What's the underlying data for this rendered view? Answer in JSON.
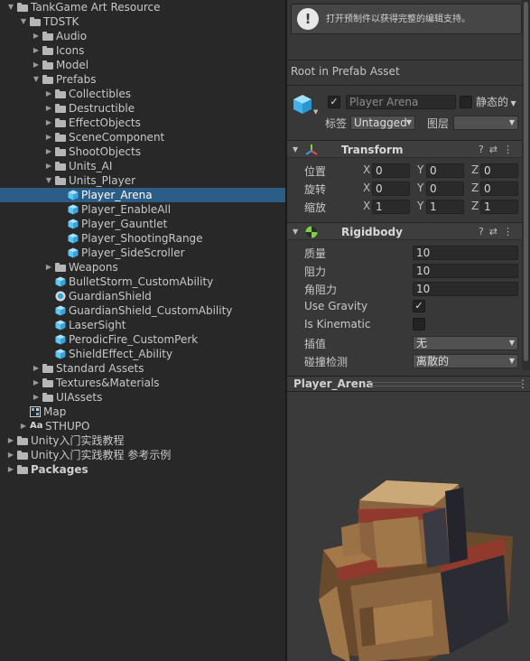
{
  "project_tree": {
    "items": [
      {
        "label": "TankGame Art Resource",
        "kind": "folder",
        "expanded": true
      },
      {
        "label": "TDSTK",
        "kind": "folder",
        "expanded": true
      },
      {
        "label": "Audio",
        "kind": "folder",
        "expanded": false
      },
      {
        "label": "Icons",
        "kind": "folder",
        "expanded": false
      },
      {
        "label": "Model",
        "kind": "folder",
        "expanded": false
      },
      {
        "label": "Prefabs",
        "kind": "folder",
        "expanded": true
      },
      {
        "label": "Collectibles",
        "kind": "folder",
        "expanded": false
      },
      {
        "label": "Destructible",
        "kind": "folder",
        "expanded": false
      },
      {
        "label": "EffectObjects",
        "kind": "folder",
        "expanded": false
      },
      {
        "label": "SceneComponent",
        "kind": "folder",
        "expanded": false
      },
      {
        "label": "ShootObjects",
        "kind": "folder",
        "expanded": false
      },
      {
        "label": "Units_AI",
        "kind": "folder",
        "expanded": false
      },
      {
        "label": "Units_Player",
        "kind": "folder",
        "expanded": true
      },
      {
        "label": "Player_Arena",
        "kind": "prefab",
        "selected": true
      },
      {
        "label": "Player_EnableAll",
        "kind": "prefab"
      },
      {
        "label": "Player_Gauntlet",
        "kind": "prefab"
      },
      {
        "label": "Player_ShootingRange",
        "kind": "prefab"
      },
      {
        "label": "Player_SideScroller",
        "kind": "prefab"
      },
      {
        "label": "Weapons",
        "kind": "folder",
        "expanded": false
      },
      {
        "label": "BulletStorm_CustomAbility",
        "kind": "prefab"
      },
      {
        "label": "GuardianShield",
        "kind": "shield"
      },
      {
        "label": "GuardianShield_CustomAbility",
        "kind": "prefab"
      },
      {
        "label": "LaserSight",
        "kind": "prefab"
      },
      {
        "label": "PerodicFire_CustomPerk",
        "kind": "prefab"
      },
      {
        "label": "ShieldEffect_Ability",
        "kind": "prefab"
      },
      {
        "label": "Standard Assets",
        "kind": "folder",
        "expanded": false
      },
      {
        "label": "Textures&Materials",
        "kind": "folder",
        "expanded": false
      },
      {
        "label": "UIAssets",
        "kind": "folder",
        "expanded": false
      },
      {
        "label": "Map",
        "kind": "scene"
      },
      {
        "label": "STHUPO",
        "kind": "font",
        "font_badge": "Aa",
        "expanded": false
      },
      {
        "label": "Unity入门实践教程",
        "kind": "folder",
        "expanded": false
      },
      {
        "label": "Unity入门实践教程 参考示例",
        "kind": "folder",
        "expanded": false
      },
      {
        "label": "Packages",
        "kind": "folder",
        "expanded": false,
        "bold": true
      }
    ]
  },
  "inspector": {
    "help_message": "打开预制件以获得完整的编辑支持。",
    "root_label": "Root in Prefab Asset",
    "gameobject": {
      "active": true,
      "name": "Player Arena",
      "static_label": "静态的",
      "static_checked": false,
      "tag_label": "标签",
      "tag_value": "Untagged",
      "layer_label": "图层",
      "layer_value": ""
    },
    "transform": {
      "title": "Transform",
      "rows": [
        {
          "label": "位置",
          "x": "0",
          "y": "0",
          "z": "0"
        },
        {
          "label": "旋转",
          "x": "0",
          "y": "0",
          "z": "0"
        },
        {
          "label": "缩放",
          "x": "1",
          "y": "1",
          "z": "1"
        }
      ],
      "axes": [
        "X",
        "Y",
        "Z"
      ]
    },
    "rigidbody": {
      "title": "Rigidbody",
      "mass_label": "质量",
      "mass": "10",
      "drag_label": "阻力",
      "drag": "10",
      "angular_drag_label": "角阻力",
      "angular_drag": "10",
      "use_gravity_label": "Use Gravity",
      "use_gravity": true,
      "is_kinematic_label": "Is Kinematic",
      "is_kinematic": false,
      "interpolate_label": "插值",
      "interpolate": "无",
      "collision_label": "碰撞检测",
      "collision": "离散的"
    },
    "preview": {
      "title": "Player_Arena"
    }
  },
  "colors": {
    "selection": "#2c5d87",
    "panel": "#383838",
    "tree_bg": "#282828",
    "prefab_icon": "#5bc8f5",
    "rigidbody_icon": "#7ed23a"
  },
  "icons": {
    "folder": "folder-icon",
    "prefab": "prefab-cube-icon",
    "shield": "guardian-shield-icon",
    "scene": "scene-map-icon",
    "font": "font-aa-icon",
    "help": "exclamation-icon",
    "transform": "transform-axes-icon",
    "rigidbody": "rigidbody-ball-icon",
    "settings": "settings-icon",
    "presets": "presets-icon",
    "more": "kebab-menu-icon"
  }
}
